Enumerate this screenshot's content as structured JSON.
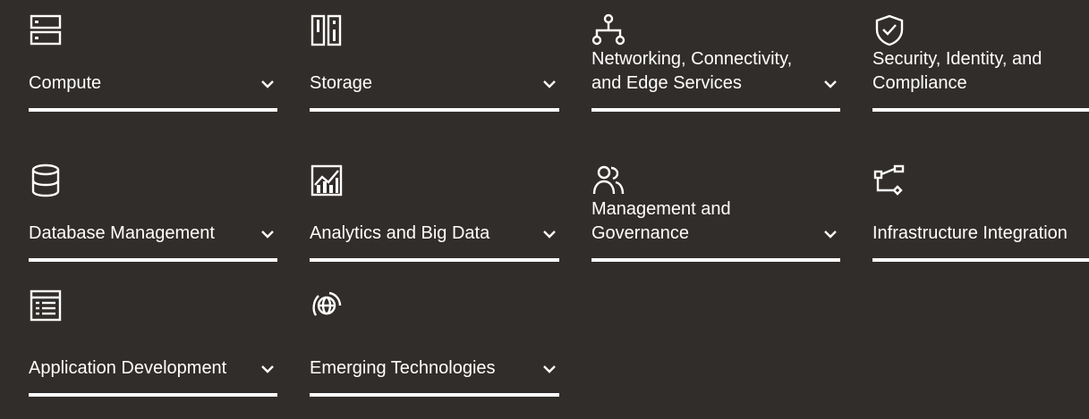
{
  "categories": [
    {
      "label": "Compute",
      "icon": "server-icon"
    },
    {
      "label": "Storage",
      "icon": "storage-icon"
    },
    {
      "label": "Networking, Connectivity, and Edge Services",
      "icon": "network-icon"
    },
    {
      "label": "Security, Identity, and Compliance",
      "icon": "shield-check-icon"
    },
    {
      "label": "Database Management",
      "icon": "database-icon"
    },
    {
      "label": "Analytics and Big Data",
      "icon": "analytics-chart-icon"
    },
    {
      "label": "Management and Governance",
      "icon": "users-icon"
    },
    {
      "label": "Infrastructure Integration",
      "icon": "integration-icon"
    },
    {
      "label": "Application Development",
      "icon": "app-window-icon"
    },
    {
      "label": "Emerging Technologies",
      "icon": "globe-orbit-icon"
    }
  ],
  "colors": {
    "background": "#312d2a",
    "foreground": "#ffffff"
  }
}
